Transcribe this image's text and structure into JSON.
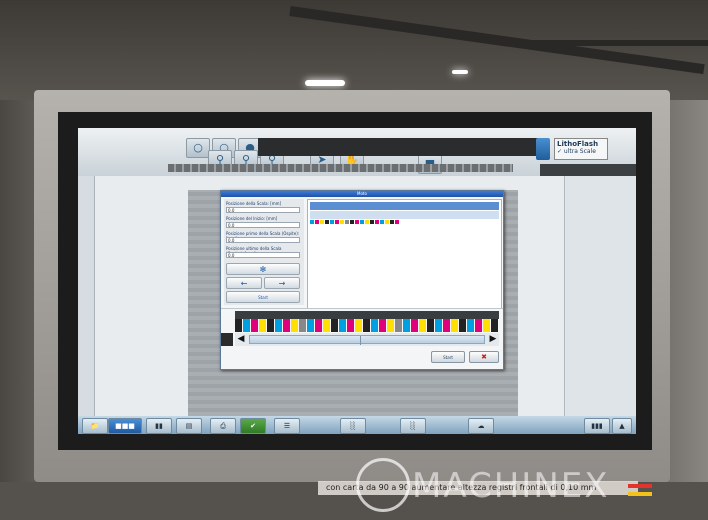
{
  "app": {
    "brand": "LithoFlash",
    "brand_sub": "✓ ultra Scale"
  },
  "dialog": {
    "title": "Moto",
    "fields": [
      {
        "label": "Posizione della Scala: [mm]",
        "value": "0.0"
      },
      {
        "label": "Posizione del Inizio: [mm]",
        "value": "0.0"
      },
      {
        "label": "Posizione primo della Scala (Ospite): [mm]",
        "value": "0.0"
      },
      {
        "label": "Posizione ultimo della Scala (Ospite): [mm]",
        "value": "0.0"
      }
    ],
    "inc_label": "Start",
    "start_label": "Start",
    "cancel_label": "✖"
  },
  "caption": "con carta da 90 a 90 aumentare altezza registri frontali di 0,10 mm",
  "watermark": "MACHINEX",
  "colors": {
    "accent": "#1f52a8",
    "screen_bg": "#e8ecef",
    "taskbar": "#7fa3bf"
  }
}
